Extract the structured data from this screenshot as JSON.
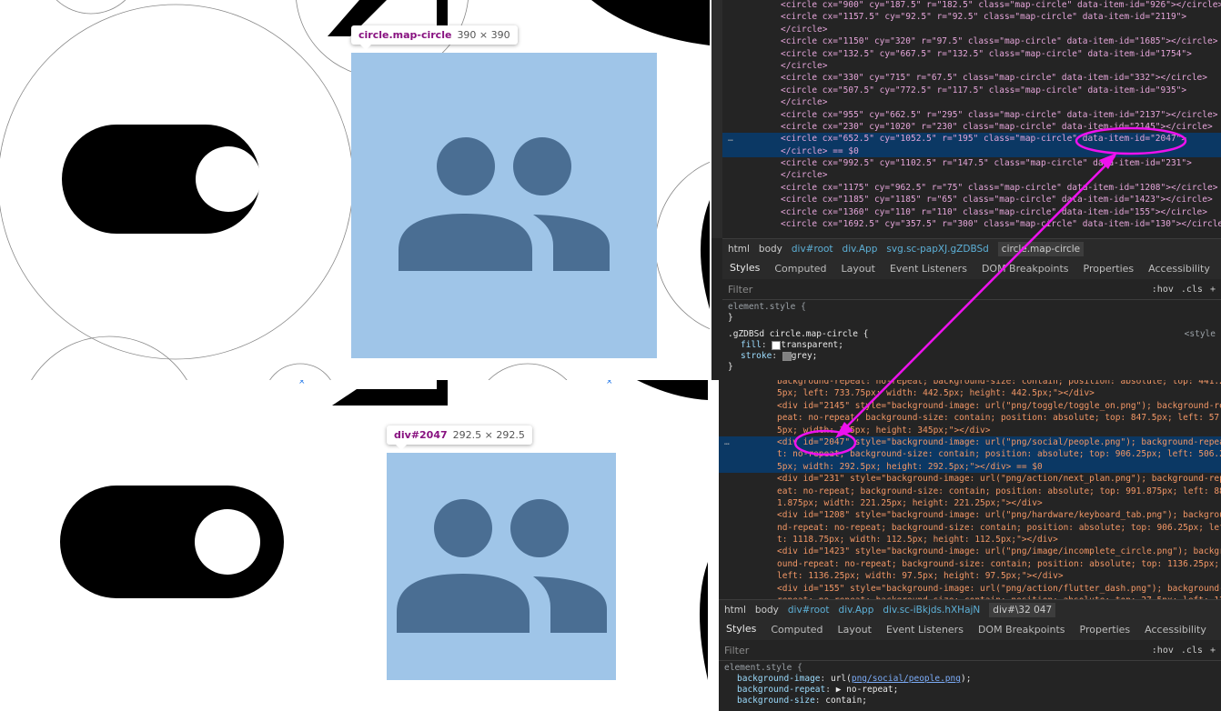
{
  "top_tooltip": {
    "selector": "circle.map-circle",
    "size": "390 × 390"
  },
  "bottom_tooltip": {
    "selector": "div#2047",
    "size": "292.5 × 292.5"
  },
  "elements_top": [
    {
      "text": "<circle cx=\"900\" cy=\"187.5\" r=\"182.5\" class=\"map-circle\" data-item-id=\"926\"></circle>"
    },
    {
      "text": "<circle cx=\"1157.5\" cy=\"92.5\" r=\"92.5\" class=\"map-circle\" data-item-id=\"2119\">"
    },
    {
      "text": "</circle>"
    },
    {
      "text": "<circle cx=\"1150\" cy=\"320\" r=\"97.5\" class=\"map-circle\" data-item-id=\"1685\"></circle>"
    },
    {
      "text": "<circle cx=\"132.5\" cy=\"667.5\" r=\"132.5\" class=\"map-circle\" data-item-id=\"1754\">"
    },
    {
      "text": "</circle>"
    },
    {
      "text": "<circle cx=\"330\" cy=\"715\" r=\"67.5\" class=\"map-circle\" data-item-id=\"332\"></circle>"
    },
    {
      "text": "<circle cx=\"507.5\" cy=\"772.5\" r=\"117.5\" class=\"map-circle\" data-item-id=\"935\">"
    },
    {
      "text": "</circle>"
    },
    {
      "text": "<circle cx=\"955\" cy=\"662.5\" r=\"295\" class=\"map-circle\" data-item-id=\"2137\"></circle>"
    },
    {
      "text": "<circle cx=\"230\" cy=\"1020\" r=\"230\" class=\"map-circle\" data-item-id=\"2145\"></circle>"
    },
    {
      "text": "<circle cx=\"652.5\" cy=\"1052.5\" r=\"195\" class=\"map-circle\" data-item-id=\"2047\">",
      "selected": true
    },
    {
      "text": "</circle> == $0",
      "selected": true
    },
    {
      "text": "<circle cx=\"992.5\" cy=\"1102.5\" r=\"147.5\" class=\"map-circle\" data-item-id=\"231\">"
    },
    {
      "text": "</circle>"
    },
    {
      "text": "<circle cx=\"1175\" cy=\"962.5\" r=\"75\" class=\"map-circle\" data-item-id=\"1208\"></circle>"
    },
    {
      "text": "<circle cx=\"1185\" cy=\"1185\" r=\"65\" class=\"map-circle\" data-item-id=\"1423\"></circle>"
    },
    {
      "text": "<circle cx=\"1360\" cy=\"110\" r=\"110\" class=\"map-circle\" data-item-id=\"155\"></circle>"
    },
    {
      "text": "<circle cx=\"1692.5\" cy=\"357.5\" r=\"300\" class=\"map-circle\" data-item-id=\"130\"></circle>"
    }
  ],
  "breadcrumb_top": [
    "html",
    "body",
    "div#root",
    "div.App",
    "svg.sc-papXJ.gZDBSd",
    "circle.map-circle"
  ],
  "panel_tabs": [
    "Styles",
    "Computed",
    "Layout",
    "Event Listeners",
    "DOM Breakpoints",
    "Properties",
    "Accessibility"
  ],
  "filter_placeholder": "Filter",
  "filter_tools": [
    ":hov",
    ".cls",
    "+"
  ],
  "styles_top": {
    "element_style": "element.style {",
    "close": "}",
    "rule_selector": ".gZDBSd circle.map-circle {",
    "rule_source": "<style",
    "props": [
      {
        "name": "fill",
        "value": "transparent;"
      },
      {
        "name": "stroke",
        "value": "grey;"
      }
    ]
  },
  "elements_bottom": [
    {
      "text": "background-repeat: no-repeat; background-size: contain; position: absolute; top: 441.2"
    },
    {
      "text": "5px; left: 733.75px; width: 442.5px; height: 442.5px;\"></div>"
    },
    {
      "text": "<div id=\"2145\" style=\"background-image: url(\"png/toggle/toggle_on.png\"); background-re"
    },
    {
      "text": "peat: no-repeat; background-size: contain; position: absolute; top: 847.5px; left: 57."
    },
    {
      "text": "5px; width: 345px; height: 345px;\"></div>"
    },
    {
      "text": "<div id=\"2047\" style=\"background-image: url(\"png/social/people.png\"); background-repea",
      "selected": true
    },
    {
      "text": "t: no-repeat; background-size: contain; position: absolute; top: 906.25px; left: 506.2",
      "selected": true
    },
    {
      "text": "5px; width: 292.5px; height: 292.5px;\"></div> == $0",
      "selected": true
    },
    {
      "text": "<div id=\"231\" style=\"background-image: url(\"png/action/next_plan.png\"); background-rep"
    },
    {
      "text": "eat: no-repeat; background-size: contain; position: absolute; top: 991.875px; left: 88"
    },
    {
      "text": "1.875px; width: 221.25px; height: 221.25px;\"></div>"
    },
    {
      "text": "<div id=\"1208\" style=\"background-image: url(\"png/hardware/keyboard_tab.png\"); backgrou"
    },
    {
      "text": "nd-repeat: no-repeat; background-size: contain; position: absolute; top: 906.25px; lef"
    },
    {
      "text": "t: 1118.75px; width: 112.5px; height: 112.5px;\"></div>"
    },
    {
      "text": "<div id=\"1423\" style=\"background-image: url(\"png/image/incomplete_circle.png\"); backgr"
    },
    {
      "text": "ound-repeat: no-repeat; background-size: contain; position: absolute; top: 1136.25px;"
    },
    {
      "text": "left: 1136.25px; width: 97.5px; height: 97.5px;\"></div>"
    },
    {
      "text": "<div id=\"155\" style=\"background-image: url(\"png/action/flutter_dash.png\"); background-"
    },
    {
      "text": "repeat: no-repeat; background-size: contain; position: absolute; top: 27.5px; left: 12"
    }
  ],
  "breadcrumb_bottom": [
    "html",
    "body",
    "div#root",
    "div.App",
    "div.sc-iBkjds.hXHajN",
    "div#\\32 047"
  ],
  "styles_bottom": {
    "element_style": "element.style {",
    "props": [
      {
        "name": "background-image",
        "value": "url(",
        "link": "png/social/people.png",
        "end": ");"
      },
      {
        "name": "background-repeat",
        "value": "▶ no-repeat;"
      },
      {
        "name": "background-size",
        "value": "contain;"
      }
    ]
  },
  "colors": {
    "highlight": "#9fc5e8",
    "icon": "#4a6e93",
    "annotation": "#ee11ee"
  }
}
